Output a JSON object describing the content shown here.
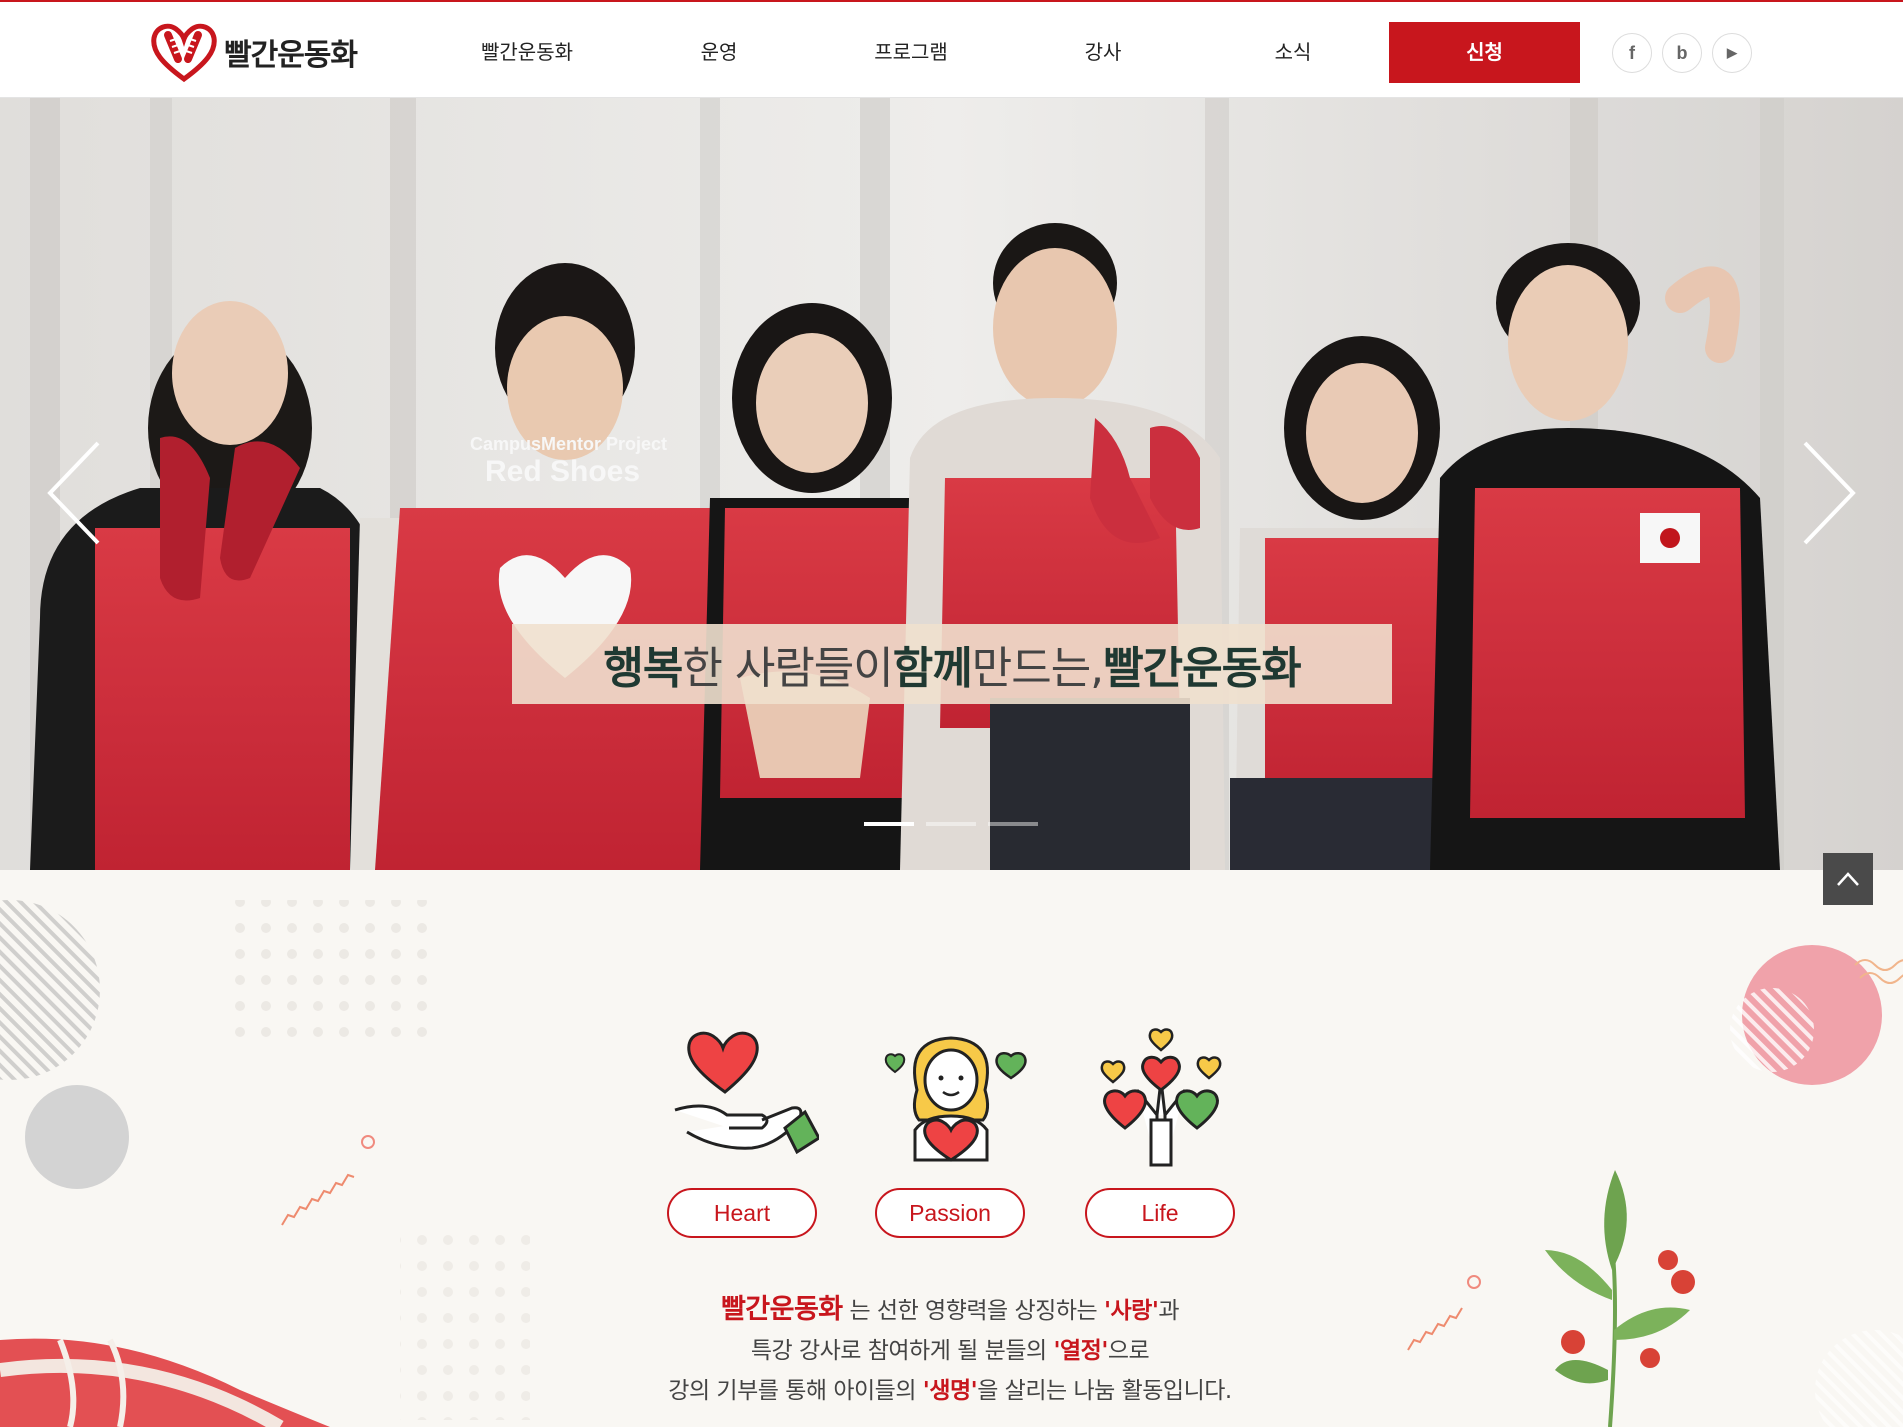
{
  "brand": {
    "name": "빨간운동화",
    "logo_icon": "heart-sneaker-logo-icon"
  },
  "nav": {
    "items": [
      "빨간운동화",
      "운영",
      "프로그램",
      "강사",
      "소식"
    ],
    "apply": "신청"
  },
  "social": [
    {
      "name": "facebook-icon",
      "glyph": "f"
    },
    {
      "name": "blog-icon",
      "glyph": "b"
    },
    {
      "name": "youtube-icon",
      "glyph": "▶"
    }
  ],
  "hero": {
    "vest_print_1": "CampusMentor Project",
    "vest_print_2": "Red Shoes",
    "caption_1": "행복",
    "caption_2": "한 사람들이 ",
    "caption_3": "함께",
    "caption_4": " 만드는, ",
    "caption_5": "빨간운동화",
    "slide_count": 3,
    "active_slide": 1,
    "prev_icon": "chevron-left-icon",
    "next_icon": "chevron-right-icon",
    "top_icon": "arrow-up-icon"
  },
  "values": [
    {
      "label": "Heart",
      "icon": "heart-hand-icon"
    },
    {
      "label": "Passion",
      "icon": "girl-heart-icon"
    },
    {
      "label": "Life",
      "icon": "heart-tree-icon"
    }
  ],
  "description": {
    "line1_brand": "빨간운동화",
    "line1_a": " 는 선한 영향력을 상징하는 ",
    "line1_em": "'사랑'",
    "line1_b": "과",
    "line2_a": "특강 강사로 참여하게 될 분들의 ",
    "line2_em": "'열정'",
    "line2_b": "으로",
    "line3_a": "강의 기부를 통해 아이들의 ",
    "line3_em": "'생명'",
    "line3_b": "을 살리는 나눔 활동입니다."
  },
  "colors": {
    "accent": "#c8161d",
    "caption_bold": "#1f3932",
    "section_bg": "#f9f7f3"
  }
}
